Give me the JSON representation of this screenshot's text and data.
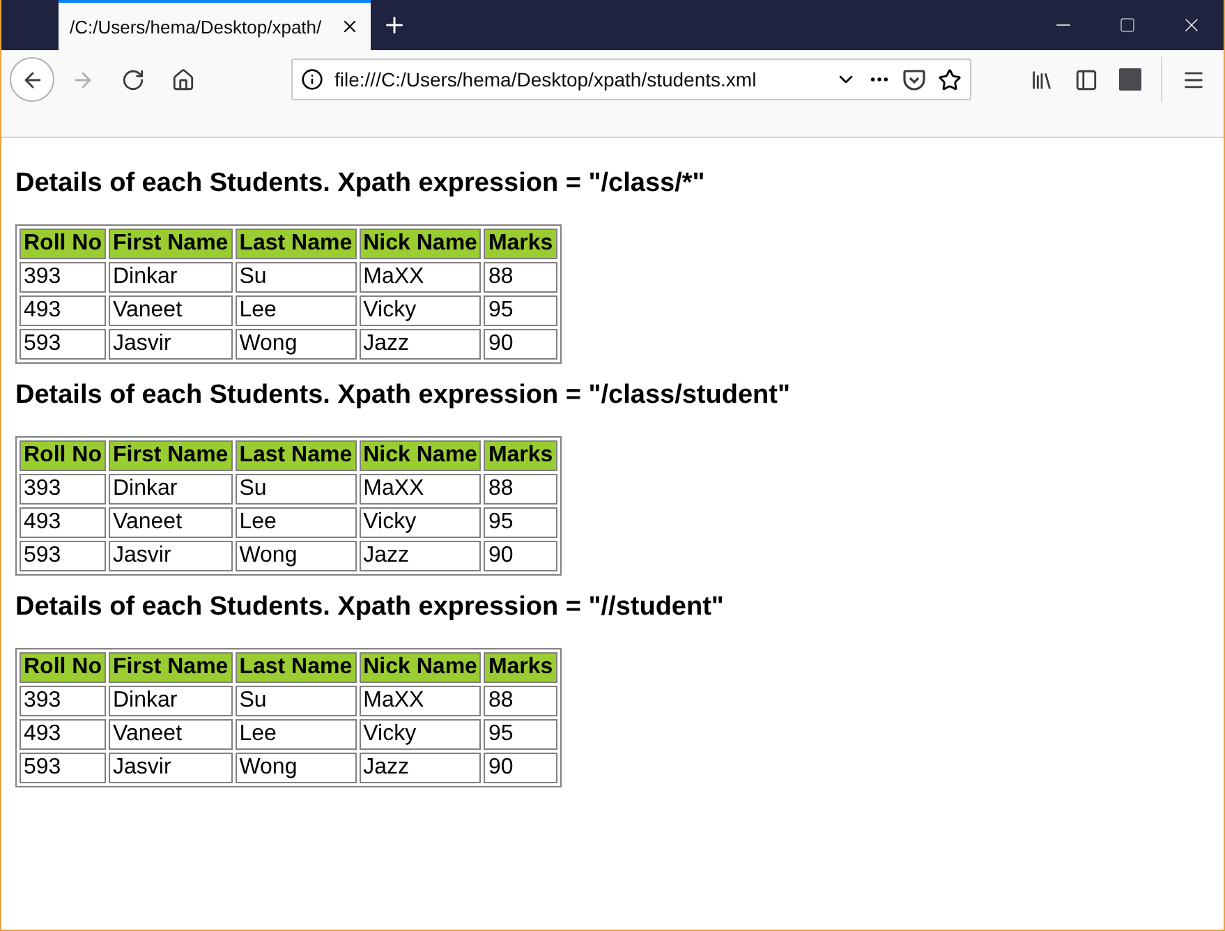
{
  "tabs": [
    {
      "label": "/C:/Users/hema/Desktop/xpath/",
      "selected": true
    }
  ],
  "address_bar": {
    "value": "file:///C:/Users/hema/Desktop/xpath/students.xml"
  },
  "sections": [
    {
      "heading": "Details of each Students. Xpath expression = \"/class/*\"",
      "columns": [
        "Roll No",
        "First Name",
        "Last Name",
        "Nick Name",
        "Marks"
      ],
      "rows": [
        [
          "393",
          "Dinkar",
          "Su",
          "MaXX",
          "88"
        ],
        [
          "493",
          "Vaneet",
          "Lee",
          "Vicky",
          "95"
        ],
        [
          "593",
          "Jasvir",
          "Wong",
          "Jazz",
          "90"
        ]
      ]
    },
    {
      "heading": "Details of each Students. Xpath expression = \"/class/student\"",
      "columns": [
        "Roll No",
        "First Name",
        "Last Name",
        "Nick Name",
        "Marks"
      ],
      "rows": [
        [
          "393",
          "Dinkar",
          "Su",
          "MaXX",
          "88"
        ],
        [
          "493",
          "Vaneet",
          "Lee",
          "Vicky",
          "95"
        ],
        [
          "593",
          "Jasvir",
          "Wong",
          "Jazz",
          "90"
        ]
      ]
    },
    {
      "heading": "Details of each Students. Xpath expression = \"//student\"",
      "columns": [
        "Roll No",
        "First Name",
        "Last Name",
        "Nick Name",
        "Marks"
      ],
      "rows": [
        [
          "393",
          "Dinkar",
          "Su",
          "MaXX",
          "88"
        ],
        [
          "493",
          "Vaneet",
          "Lee",
          "Vicky",
          "95"
        ],
        [
          "593",
          "Jasvir",
          "Wong",
          "Jazz",
          "90"
        ]
      ]
    }
  ]
}
